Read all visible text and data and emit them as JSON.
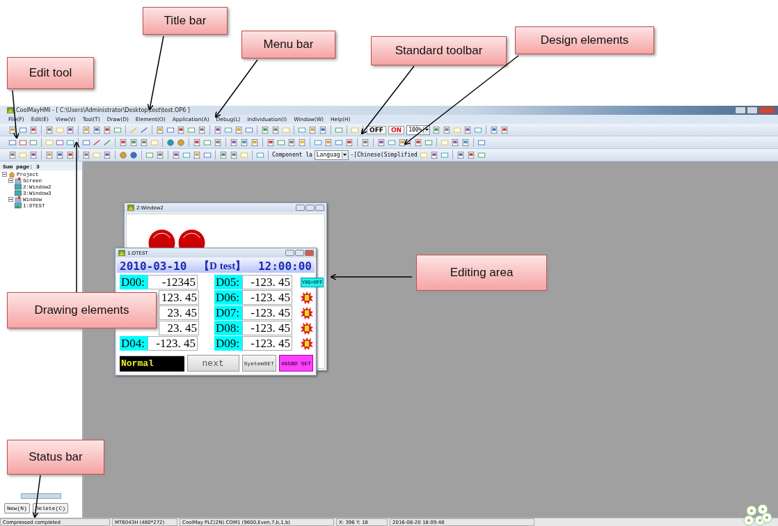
{
  "callouts": [
    {
      "label": "Title bar"
    },
    {
      "label": "Menu bar"
    },
    {
      "label": "Standard toolbar"
    },
    {
      "label": "Design elements"
    },
    {
      "label": "Edit tool"
    },
    {
      "label": "Drawing elements"
    },
    {
      "label": "Editing area"
    },
    {
      "label": "Status bar"
    }
  ],
  "window": {
    "title": "CoolMayHMI - [ C:\\Users\\Administrator\\Desktop\\test\\test.OP6 ]"
  },
  "menu": [
    "File(F)",
    "Edit(E)",
    "View(V)",
    "Tool(T)",
    "Draw(D)",
    "Element(O)",
    "Application(A)",
    "Debug(L)",
    "Individuation(I)",
    "Window(W)",
    "Help(H)"
  ],
  "toolbar": {
    "toggle_off": "OFF",
    "toggle_on": "ON",
    "zoom": "100%",
    "component_label": "Component la",
    "language_select": "Languag",
    "language": "-[Chinese(Simplified"
  },
  "project_panel": {
    "title": "Sum page: 3",
    "tree": [
      {
        "label": "Project",
        "kind": "project",
        "expanded": true,
        "children": [
          {
            "label": "Screen",
            "kind": "folder",
            "expanded": true,
            "children": [
              {
                "label": "2:Window2",
                "kind": "screen"
              },
              {
                "label": "3:Window3",
                "kind": "screen"
              }
            ]
          },
          {
            "label": "Window",
            "kind": "folder",
            "expanded": true,
            "children": [
              {
                "label": "1:DTEST",
                "kind": "window"
              }
            ]
          }
        ]
      }
    ],
    "buttons": [
      "New(N)",
      "Delete(C)"
    ]
  },
  "windows": [
    {
      "title": "2:Window2"
    },
    {
      "title": "1:DTEST",
      "date": "2010-03-10",
      "tag": "【D test】",
      "time": "12:00:00",
      "rows": [
        {
          "left": {
            "label": "D00:",
            "value": "-12345"
          },
          "right": {
            "label": "D05:",
            "value": "-123. 45"
          },
          "indicator": {
            "kind": "text",
            "label": "Y05=OFF"
          }
        },
        {
          "left": {
            "value": "123. 45"
          },
          "right": {
            "label": "D06:",
            "value": "-123. 45"
          },
          "indicator": {
            "kind": "alarm"
          }
        },
        {
          "left": {
            "value": "23. 45"
          },
          "right": {
            "label": "D07:",
            "value": "-123. 45"
          },
          "indicator": {
            "kind": "alarm"
          }
        },
        {
          "left": {
            "value": "23. 45"
          },
          "right": {
            "label": "D08:",
            "value": "-123. 45"
          },
          "indicator": {
            "kind": "alarm"
          }
        },
        {
          "left": {
            "label": "D04:",
            "value": "-123. 45"
          },
          "right": {
            "label": "D09:",
            "value": "-123. 45"
          },
          "indicator": {
            "kind": "alarm"
          }
        }
      ],
      "buttons": [
        {
          "label": "Normal",
          "kind": "status"
        },
        {
          "label": "next",
          "kind": "button"
        },
        {
          "label": "SyetemSET",
          "kind": "button"
        },
        {
          "label": "485BD SET",
          "kind": "pink"
        }
      ]
    }
  ],
  "status_bar": [
    "Compressed completed",
    "MT6043H (480*272)",
    "CoolMay PLC(2N)  COM1 (9600,Even,7,b,1,b)",
    "X: 396  Y: 18",
    "2016-08-20  18:09:48"
  ]
}
